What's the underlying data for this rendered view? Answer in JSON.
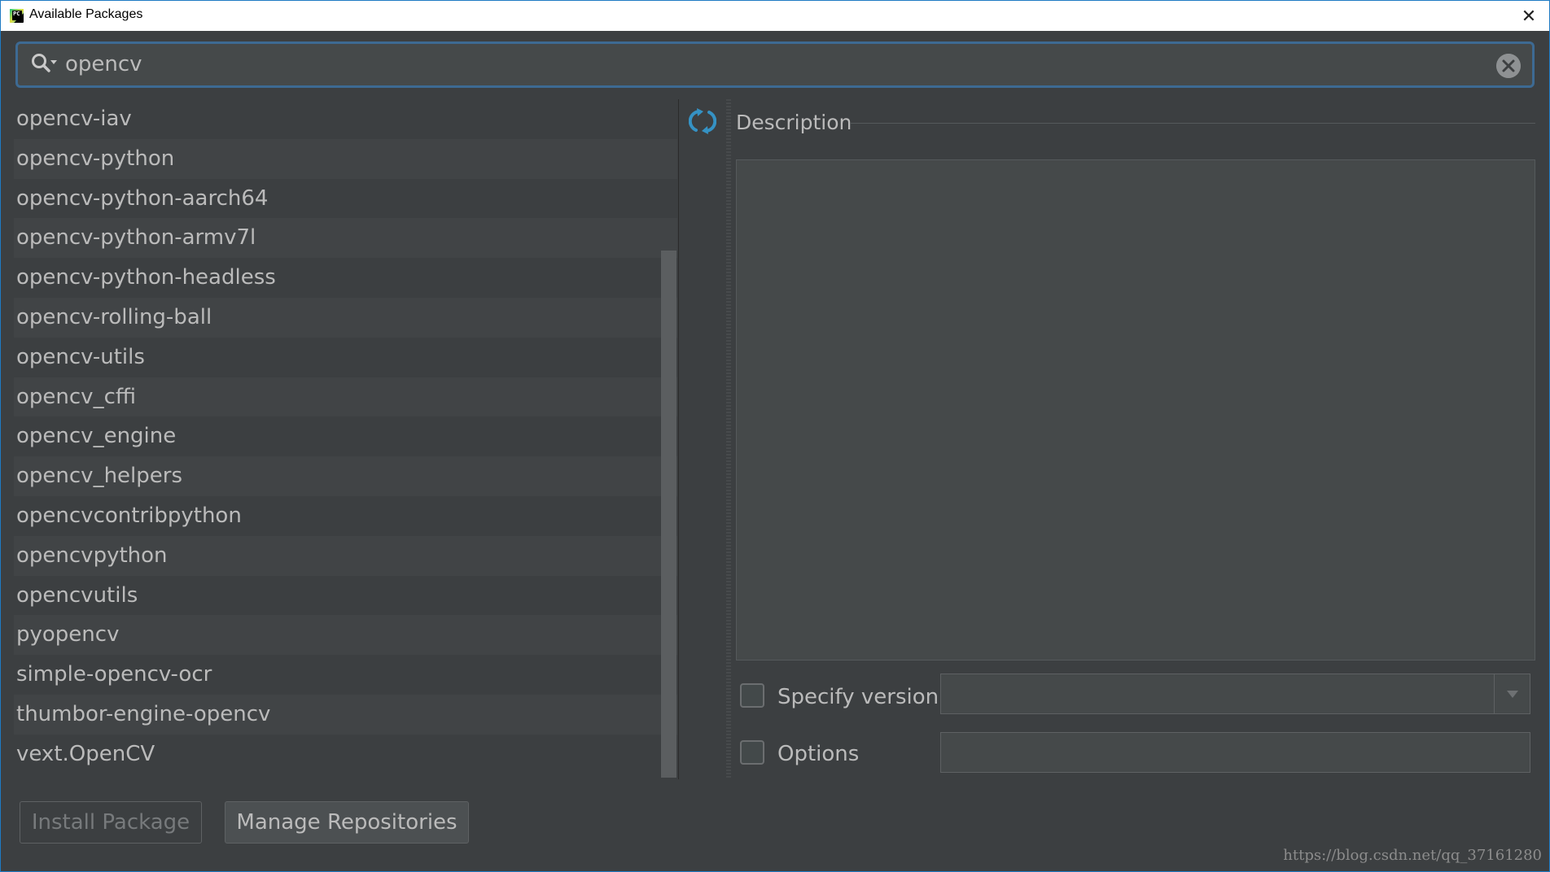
{
  "window": {
    "title": "Available Packages",
    "close_symbol": "✕"
  },
  "search": {
    "value": "opencv",
    "icon": "search-icon",
    "clear_icon": "clear-icon"
  },
  "packages": [
    "opencv-iav",
    "opencv-python",
    "opencv-python-aarch64",
    "opencv-python-armv7l",
    "opencv-python-headless",
    "opencv-rolling-ball",
    "opencv-utils",
    "opencv_cffi",
    "opencv_engine",
    "opencv_helpers",
    "opencvcontribpython",
    "opencvpython",
    "opencvutils",
    "pyopencv",
    "simple-opencv-ocr",
    "thumbor-engine-opencv",
    "vext.OpenCV"
  ],
  "details": {
    "description_label": "Description",
    "description_text": "",
    "specify_version_label": "Specify version",
    "specify_version_checked": false,
    "version_value": "",
    "options_label": "Options",
    "options_checked": false,
    "options_value": ""
  },
  "buttons": {
    "install": "Install Package",
    "manage": "Manage Repositories"
  },
  "watermark": "https://blog.csdn.net/qq_37161280",
  "colors": {
    "background": "#3c3f41",
    "field": "#45494a",
    "focus_border": "#3d6a93",
    "refresh_icon": "#3592c4",
    "text": "#bbbbbb"
  }
}
